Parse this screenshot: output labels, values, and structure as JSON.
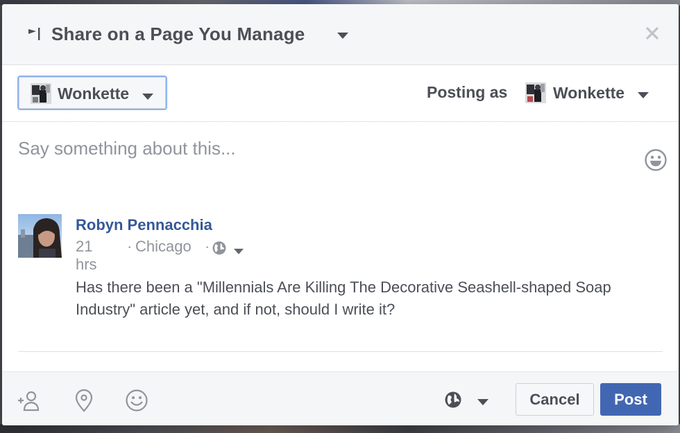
{
  "dialog": {
    "title": "Share on a Page You Manage",
    "close_icon": "close-icon",
    "flag_icon": "flag-icon"
  },
  "page_selector": {
    "selected_page": "Wonkette",
    "posting_as_label": "Posting as",
    "posting_as_value": "Wonkette"
  },
  "composer": {
    "placeholder": "Say something about this...",
    "emoji_icon": "smiley-icon"
  },
  "shared_post": {
    "author": "Robyn Pennacchia",
    "time": "21 hrs",
    "separator": "·",
    "location": "Chicago",
    "dot": "·",
    "privacy_icon": "globe-icon",
    "text": "Has there been a \"Millennials Are Killing The Decorative Seashell-shaped Soap Industry\" article yet, and if not, should I write it?"
  },
  "footer": {
    "tag_icon": "tag-friends-icon",
    "location_icon": "location-pin-icon",
    "feeling_icon": "feeling-smiley-icon",
    "audience_icon": "globe-icon",
    "cancel_label": "Cancel",
    "post_label": "Post"
  },
  "colors": {
    "brand_blue": "#4267b2",
    "link_blue": "#365899",
    "muted_text": "#90949c",
    "header_bg": "#f5f6f7"
  }
}
